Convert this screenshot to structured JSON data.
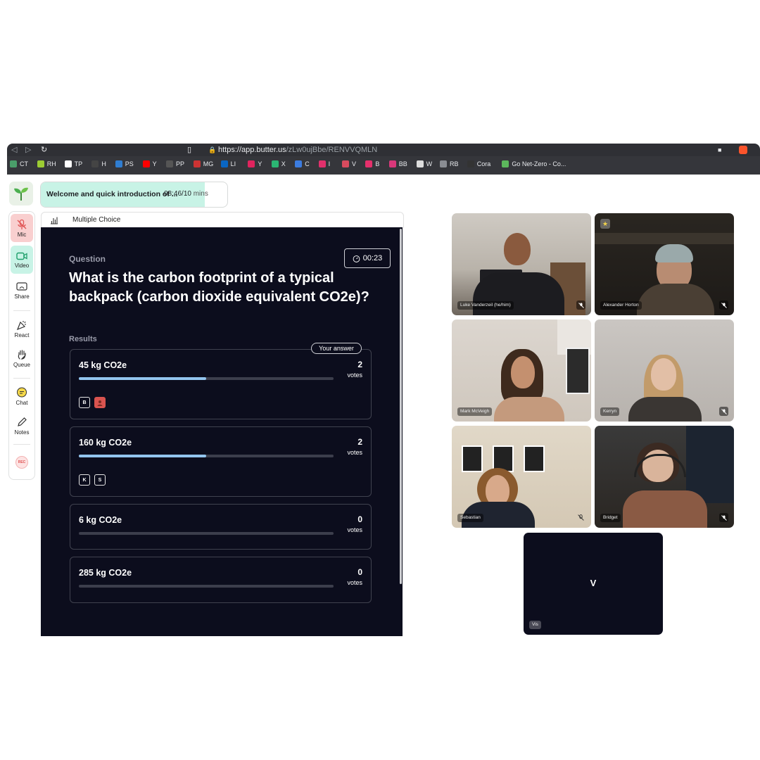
{
  "browser": {
    "url_host": "https://app.butter.us",
    "url_path": "/zLw0ujBbe/RENVVQMLN",
    "bookmarks": [
      {
        "label": "CT",
        "color": "#4a9e6a"
      },
      {
        "label": "RH",
        "color": "#9ccc33"
      },
      {
        "label": "TP",
        "color": "#ffffff"
      },
      {
        "label": "H",
        "color": "#444444"
      },
      {
        "label": "PS",
        "color": "#2f7dd1"
      },
      {
        "label": "Y",
        "color": "#ff0000"
      },
      {
        "label": "PP",
        "color": "#555555"
      },
      {
        "label": "MG",
        "color": "#cc3333"
      },
      {
        "label": "LI",
        "color": "#0a66c2"
      },
      {
        "label": "Y",
        "color": "#e0245e"
      },
      {
        "label": "X",
        "color": "#2bb673"
      },
      {
        "label": "C",
        "color": "#3c7ce0"
      },
      {
        "label": "I",
        "color": "#e1306c"
      },
      {
        "label": "V",
        "color": "#d94b5e"
      },
      {
        "label": "B",
        "color": "#e5306c"
      },
      {
        "label": "BB",
        "color": "#d9387a"
      },
      {
        "label": "W",
        "color": "#dddddd"
      },
      {
        "label": "RB",
        "color": "#8a8d93"
      },
      {
        "label": "Cora",
        "color": "#333333"
      },
      {
        "label": "Go Net-Zero - Co...",
        "color": "#5cb85c"
      }
    ]
  },
  "agenda": {
    "title": "Welcome and quick introduction of ...",
    "elapsed": "08:46/",
    "total": "10",
    "unit": " mins",
    "progress_fraction": 0.88
  },
  "toolbar": {
    "items": [
      {
        "label": "Mic",
        "icon": "mic-muted-icon"
      },
      {
        "label": "Video",
        "icon": "video-icon"
      },
      {
        "label": "Share",
        "icon": "share-icon"
      },
      {
        "label": "React",
        "icon": "react-icon"
      },
      {
        "label": "Queue",
        "icon": "hand-icon"
      },
      {
        "label": "Chat",
        "icon": "chat-icon"
      },
      {
        "label": "Notes",
        "icon": "pencil-icon"
      }
    ],
    "rec_label": "REC"
  },
  "poll": {
    "header_label": "Multiple Choice",
    "question_label": "Question",
    "question_text": "What is the carbon footprint of a typical backpack (carbon dioxide equivalent CO2e)?",
    "timer": "00:23",
    "results_label": "Results",
    "your_answer_label": "Your answer",
    "options": [
      {
        "label": "45 kg CO2e",
        "votes": "2",
        "votes_label": "votes",
        "fraction": 0.5,
        "voters": [
          "B",
          ""
        ]
      },
      {
        "label": "160 kg CO2e",
        "votes": "2",
        "votes_label": "votes",
        "fraction": 0.5,
        "voters": [
          "K",
          "S"
        ]
      },
      {
        "label": "6 kg CO2e",
        "votes": "0",
        "votes_label": "votes",
        "fraction": 0,
        "voters": []
      },
      {
        "label": "285 kg CO2e",
        "votes": "0",
        "votes_label": "votes",
        "fraction": 0,
        "voters": []
      }
    ]
  },
  "participants": [
    {
      "name": "Luke Vanderzeil (he/him)",
      "muted": true,
      "starred": false
    },
    {
      "name": "Alexander Horton",
      "muted": true,
      "starred": true
    },
    {
      "name": "Mark McVeigh",
      "muted": false,
      "starred": false
    },
    {
      "name": "Kerryn",
      "muted": true,
      "starred": false
    },
    {
      "name": "Sebastian",
      "muted": true,
      "starred": false
    },
    {
      "name": "Bridget",
      "muted": true,
      "starred": false
    },
    {
      "name": "Vis",
      "initial": "V",
      "muted": false,
      "starred": false
    }
  ]
}
